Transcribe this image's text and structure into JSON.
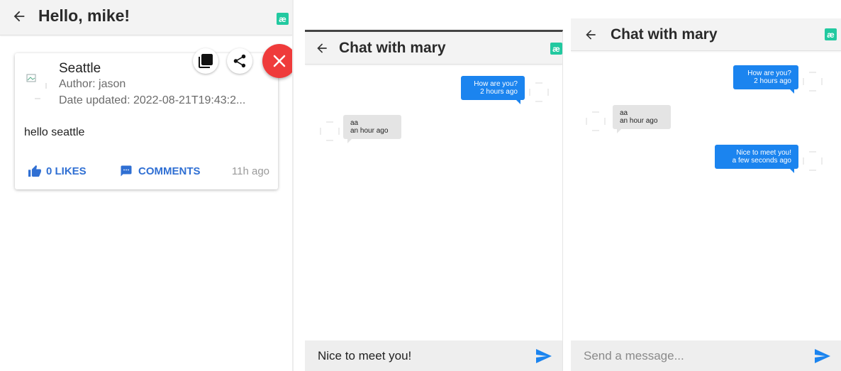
{
  "screen_feed": {
    "title": "Hello, mike!",
    "logo_text": "æ",
    "post": {
      "place": "Seattle",
      "author": "Author: jason",
      "date_updated": "Date updated: 2022-08-21T19:43:2...",
      "body": "hello seattle",
      "likes_label": "0 LIKES",
      "comments_label": "COMMENTS",
      "time_ago": "11h ago"
    }
  },
  "screen_chat_typing": {
    "title": "Chat with mary",
    "logo_text": "æ",
    "messages": [
      {
        "direction": "out",
        "text": "How are you?",
        "time": "2 hours ago"
      },
      {
        "direction": "in",
        "text": "aa",
        "time": "an hour ago"
      }
    ],
    "input_value": "Nice to meet you!"
  },
  "screen_chat_sent": {
    "title": "Chat with mary",
    "logo_text": "æ",
    "messages": [
      {
        "direction": "out",
        "text": "How are you?",
        "time": "2 hours ago"
      },
      {
        "direction": "in",
        "text": "aa",
        "time": "an hour ago"
      },
      {
        "direction": "out",
        "text": "Nice to meet you!",
        "time": "a few seconds ago"
      }
    ],
    "input_placeholder": "Send  a message..."
  },
  "colors": {
    "accent_blue": "#1b84ef",
    "link_blue": "#2f6fd3",
    "close_red": "#ef3b3b",
    "logo_green": "#22c9a0"
  }
}
